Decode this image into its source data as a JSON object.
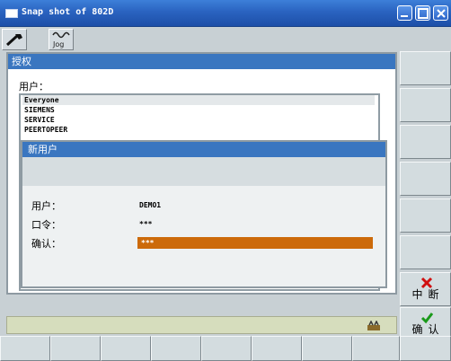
{
  "window": {
    "title": "Snap shot of 802D",
    "app_icon": "window-icon",
    "controls": [
      "minimize-icon",
      "maximize-icon",
      "close-icon"
    ]
  },
  "toolbar": {
    "tools": [
      {
        "icon": "wrench-icon"
      },
      {
        "icon": "jog-icon",
        "label": "Jog"
      }
    ]
  },
  "auth_dialog": {
    "title": "授权",
    "user_label": "用户：",
    "users": [
      "Everyone",
      "SIEMENS",
      "SERVICE",
      "PEERTOPEER"
    ]
  },
  "new_user_dialog": {
    "title": "新用户",
    "fields": [
      {
        "label": "用户：",
        "value": "DEMO1"
      },
      {
        "label": "口令：",
        "value": "***"
      },
      {
        "label": "确认：",
        "value": "***"
      }
    ]
  },
  "softkeys": {
    "cancel_label": "中断",
    "ok_label": "确认",
    "cancel_icon": "x-mark-icon",
    "ok_icon": "check-mark-icon"
  },
  "status": {
    "icon": "status-machine-icon"
  },
  "colors": {
    "titlebar": "#2a63c0",
    "dialog_header": "#3a76c0",
    "focus_field": "#cc6a0a",
    "status_bar": "#d6ddbd"
  }
}
